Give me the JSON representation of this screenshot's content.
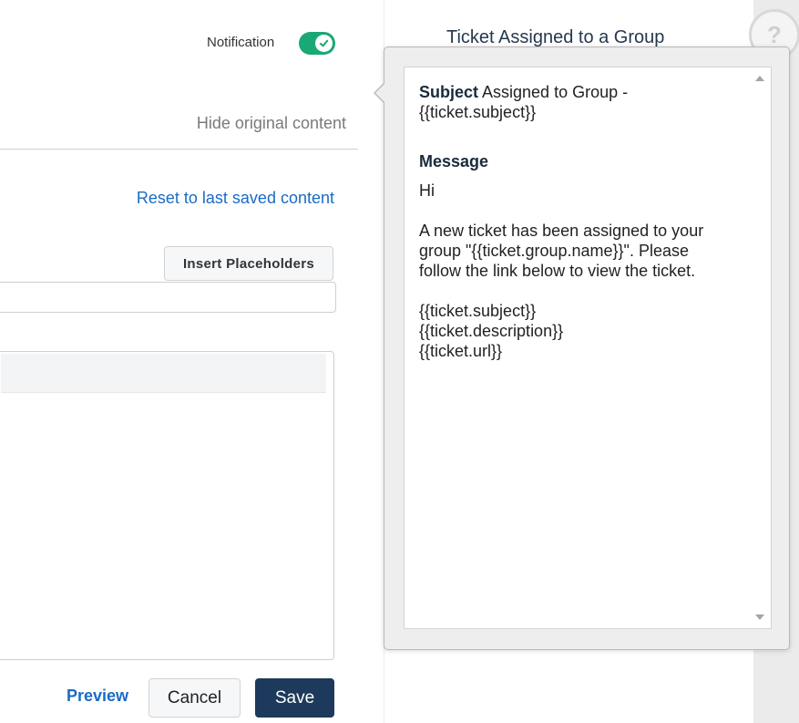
{
  "settings": {
    "notification_label": "Notification",
    "notification_enabled": true,
    "hide_original_label": "Hide original content",
    "reset_label": "Reset to last saved content",
    "insert_placeholders_label": "Insert Placeholders"
  },
  "actions": {
    "preview_label": "Preview",
    "cancel_label": "Cancel",
    "save_label": "Save"
  },
  "background_panel": {
    "title": "Ticket Assigned to a Group"
  },
  "popover": {
    "subject_heading": "Subject",
    "subject_text": " Assigned to Group - {{ticket.subject}}",
    "message_heading": "Message",
    "message_lines": {
      "greeting": "Hi",
      "body": "A new ticket has been assigned to your group \"{{ticket.group.name}}\". Please follow the link below to view the ticket.",
      "placeholder_1": "{{ticket.subject}}",
      "placeholder_2": "{{ticket.description}}",
      "placeholder_3": "{{ticket.url}}"
    }
  },
  "icons": {
    "toggle_check": "check-icon",
    "help": "question-mark-icon",
    "scroll_up": "triangle-up-icon",
    "scroll_down": "triangle-down-icon"
  },
  "help_glyph": "?",
  "colors": {
    "toggle_on": "#1aa874",
    "link": "#1a6bc5",
    "save_button": "#1d3a5c"
  }
}
